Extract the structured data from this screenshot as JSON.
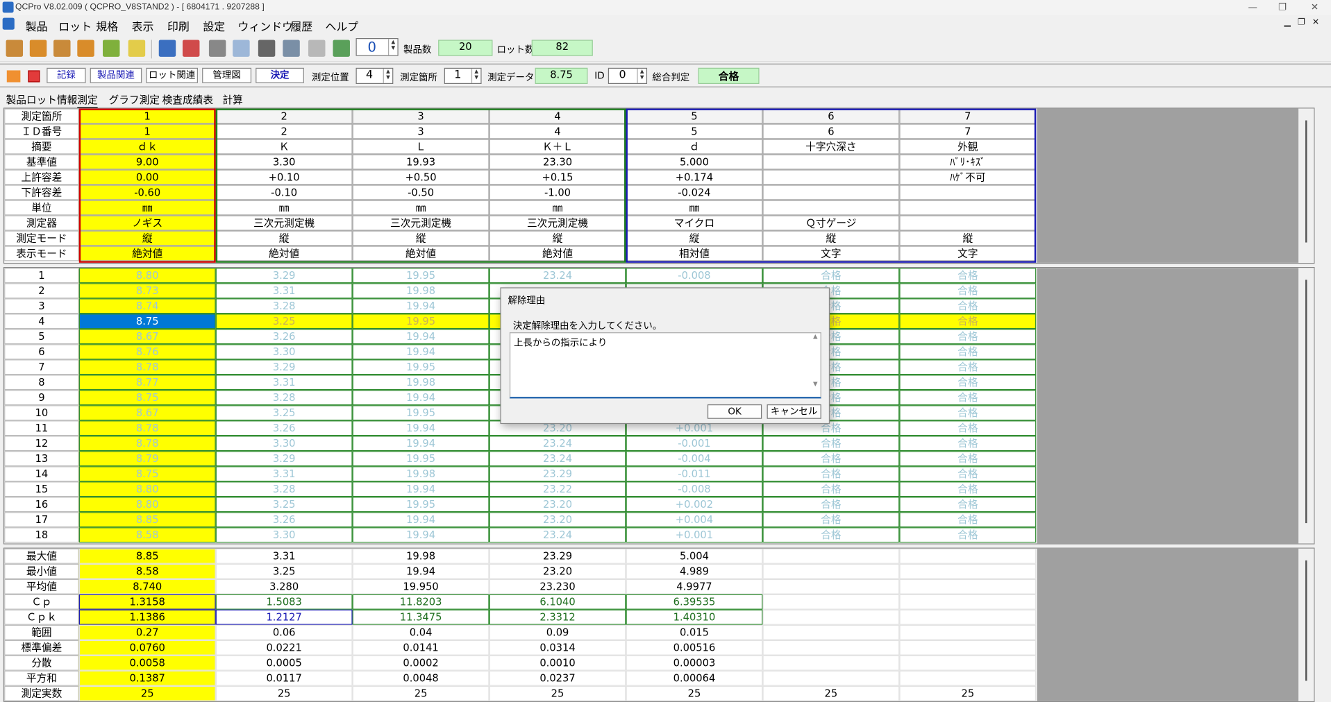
{
  "window": {
    "title": "QCPro V8.02.009 ( QCPRO_V8STAND2 )  - [ 6804171 . 9207288 ]"
  },
  "menu": [
    "製品",
    "ロット",
    "規格",
    "表示",
    "印刷",
    "設定",
    "ウィンドウ",
    "履歴",
    "ヘルプ"
  ],
  "toolbar": {
    "counter": "0",
    "product_count_label": "製品数",
    "product_count": "20",
    "lot_count_label": "ロット数",
    "lot_count": "82"
  },
  "subbar": {
    "record": "記録",
    "product_related": "製品関連",
    "lot_related": "ロット関連",
    "control_chart": "管理図",
    "confirm": "決定",
    "pos_label": "測定位置",
    "pos": "4",
    "point_label": "測定箇所",
    "point": "1",
    "data_label": "測定データ",
    "data": "8.75",
    "id_label": "ID",
    "id": "0",
    "judge_label": "総合判定",
    "judge": "合格"
  },
  "tabs": [
    "製品ロット情報",
    "測定",
    "グラフ測定",
    "検査成績表",
    "計算"
  ],
  "spec_headers": [
    "測定箇所",
    "ＩＤ番号",
    "摘要",
    "基準値",
    "上許容差",
    "下許容差",
    "単位",
    "測定器",
    "測定モード",
    "表示モード"
  ],
  "spec_cols": [
    [
      "1",
      "1",
      "ｄｋ",
      "9.00",
      "0.00",
      "-0.60",
      "㎜",
      "ノギス",
      "縦",
      "絶対値"
    ],
    [
      "2",
      "2",
      "Ｋ",
      "3.30",
      "+0.10",
      "-0.10",
      "㎜",
      "三次元測定機",
      "縦",
      "絶対値"
    ],
    [
      "3",
      "3",
      "Ｌ",
      "19.93",
      "+0.50",
      "-0.50",
      "㎜",
      "三次元測定機",
      "縦",
      "絶対値"
    ],
    [
      "4",
      "4",
      "Ｋ＋Ｌ",
      "23.30",
      "+0.15",
      "-1.00",
      "㎜",
      "三次元測定機",
      "縦",
      "絶対値"
    ],
    [
      "5",
      "5",
      "ｄ",
      "5.000",
      "+0.174",
      "-0.024",
      "㎜",
      "マイクロ",
      "縦",
      "相対値"
    ],
    [
      "6",
      "6",
      "十字穴深さ",
      "",
      "",
      "",
      "",
      "Ｑ寸ゲージ",
      "縦",
      "文字"
    ],
    [
      "7",
      "7",
      "外観",
      "ﾊﾞﾘ･ｷｽﾞ",
      "ﾊｹﾞ不可",
      "",
      "",
      "",
      "縦",
      "文字"
    ]
  ],
  "meas_rows": [
    [
      "1",
      "8.80",
      "3.29",
      "19.95",
      "23.24",
      "-0.008",
      "合格",
      "合格"
    ],
    [
      "2",
      "8.73",
      "3.31",
      "19.98",
      "",
      "",
      "合格",
      "合格"
    ],
    [
      "3",
      "8.74",
      "3.28",
      "19.94",
      "",
      "",
      "合格",
      "合格"
    ],
    [
      "4",
      "8.75",
      "3.25",
      "19.95",
      "",
      "",
      "合格",
      "合格"
    ],
    [
      "5",
      "8.67",
      "3.26",
      "19.94",
      "",
      "",
      "合格",
      "合格"
    ],
    [
      "6",
      "8.76",
      "3.30",
      "19.94",
      "",
      "",
      "合格",
      "合格"
    ],
    [
      "7",
      "8.78",
      "3.29",
      "19.95",
      "",
      "",
      "合格",
      "合格"
    ],
    [
      "8",
      "8.77",
      "3.31",
      "19.98",
      "",
      "",
      "合格",
      "合格"
    ],
    [
      "9",
      "8.75",
      "3.28",
      "19.94",
      "",
      "",
      "合格",
      "合格"
    ],
    [
      "10",
      "8.67",
      "3.25",
      "19.95",
      "",
      "",
      "合格",
      "合格"
    ],
    [
      "11",
      "8.78",
      "3.26",
      "19.94",
      "23.20",
      "+0.001",
      "合格",
      "合格"
    ],
    [
      "12",
      "8.78",
      "3.30",
      "19.94",
      "23.24",
      "-0.001",
      "合格",
      "合格"
    ],
    [
      "13",
      "8.79",
      "3.29",
      "19.95",
      "23.24",
      "-0.004",
      "合格",
      "合格"
    ],
    [
      "14",
      "8.75",
      "3.31",
      "19.98",
      "23.29",
      "-0.011",
      "合格",
      "合格"
    ],
    [
      "15",
      "8.80",
      "3.28",
      "19.94",
      "23.22",
      "-0.008",
      "合格",
      "合格"
    ],
    [
      "16",
      "8.80",
      "3.25",
      "19.95",
      "23.20",
      "+0.002",
      "合格",
      "合格"
    ],
    [
      "17",
      "8.85",
      "3.26",
      "19.94",
      "23.20",
      "+0.004",
      "合格",
      "合格"
    ],
    [
      "18",
      "8.58",
      "3.30",
      "19.94",
      "23.24",
      "+0.001",
      "合格",
      "合格"
    ]
  ],
  "stat_rows": [
    [
      "最大値",
      "8.85",
      "3.31",
      "19.98",
      "23.29",
      "5.004",
      "",
      ""
    ],
    [
      "最小値",
      "8.58",
      "3.25",
      "19.94",
      "23.20",
      "4.989",
      "",
      ""
    ],
    [
      "平均値",
      "8.740",
      "3.280",
      "19.950",
      "23.230",
      "4.9977",
      "",
      ""
    ],
    [
      "Ｃｐ",
      "1.3158",
      "1.5083",
      "11.8203",
      "6.1040",
      "6.39535",
      "",
      ""
    ],
    [
      "Ｃｐｋ",
      "1.1386",
      "1.2127",
      "11.3475",
      "2.3312",
      "1.40310",
      "",
      ""
    ],
    [
      "範囲",
      "0.27",
      "0.06",
      "0.04",
      "0.09",
      "0.015",
      "",
      ""
    ],
    [
      "標準偏差",
      "0.0760",
      "0.0221",
      "0.0141",
      "0.0314",
      "0.00516",
      "",
      ""
    ],
    [
      "分散",
      "0.0058",
      "0.0005",
      "0.0002",
      "0.0010",
      "0.00003",
      "",
      ""
    ],
    [
      "平方和",
      "0.1387",
      "0.0117",
      "0.0048",
      "0.0237",
      "0.00064",
      "",
      ""
    ],
    [
      "測定実数",
      "25",
      "25",
      "25",
      "25",
      "25",
      "25",
      "25"
    ]
  ],
  "dialog": {
    "title": "解除理由",
    "message": "決定解除理由を入力してください。",
    "text": "上長からの指示により",
    "ok": "OK",
    "cancel": "キャンセル"
  },
  "colors": {
    "highlight": "#ffff00",
    "selected": "#0078d7",
    "pass_text": "#9ec7d6",
    "green_border": "#2e8b2e"
  }
}
